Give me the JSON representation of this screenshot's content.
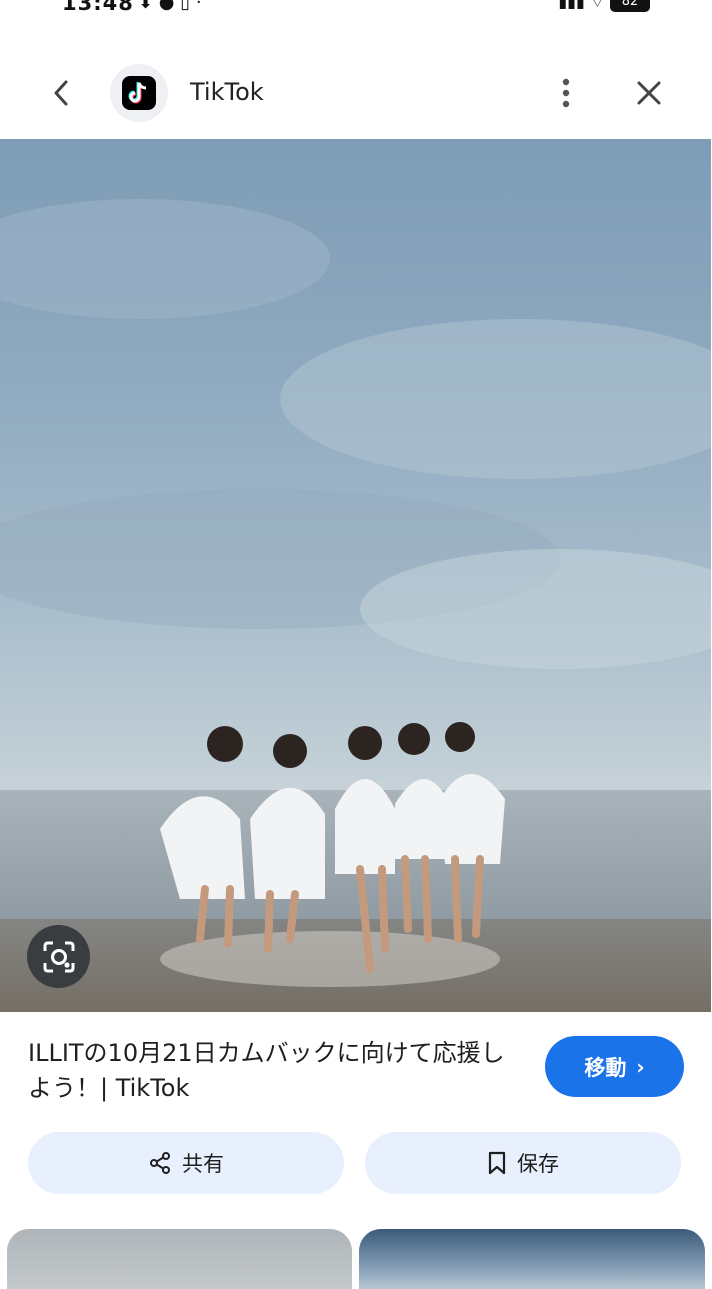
{
  "status": {
    "time": "13:48",
    "battery": "82"
  },
  "header": {
    "app_name": "TikTok",
    "back_icon": "chevron-left-icon",
    "more_icon": "more-vertical-icon",
    "close_icon": "close-icon"
  },
  "result": {
    "title": "ILLITの10月21日カムバックに向けて応援しよう！| TikTok",
    "visit_label": "移動",
    "visit_color": "#1a73e8"
  },
  "actions": {
    "share_label": "共有",
    "save_label": "保存"
  }
}
